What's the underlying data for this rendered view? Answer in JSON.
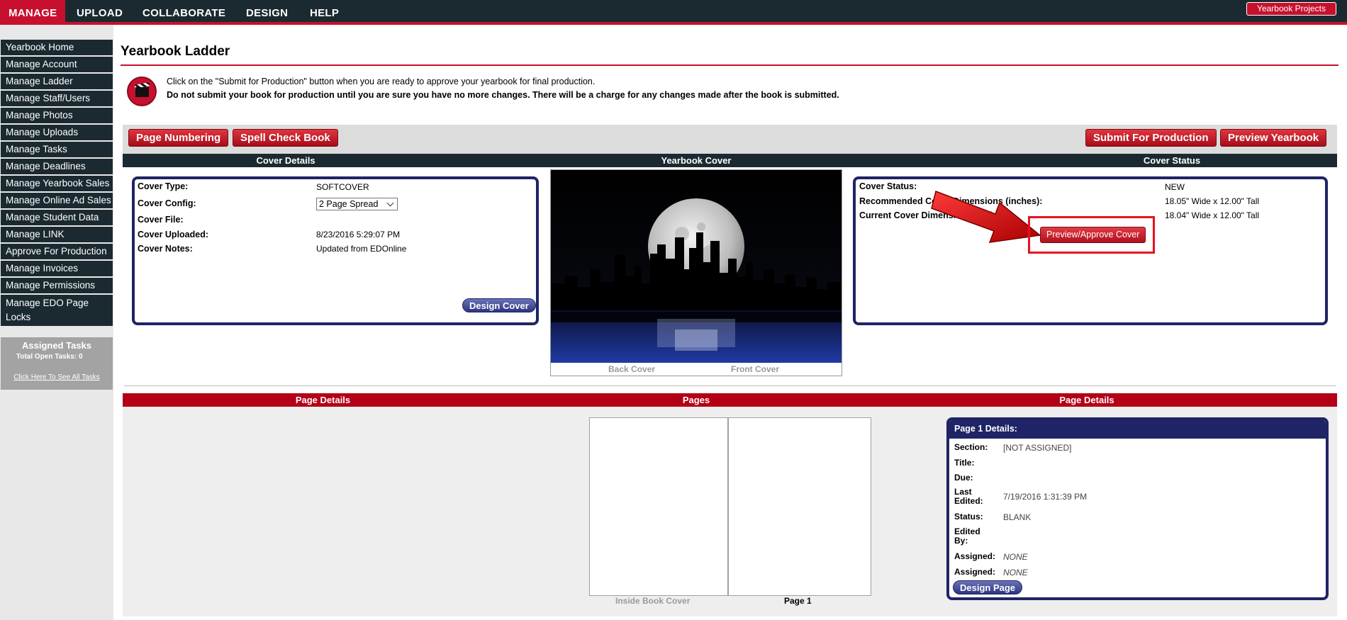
{
  "nav": {
    "tabs": [
      "MANAGE",
      "UPLOAD",
      "COLLABORATE",
      "DESIGN",
      "HELP"
    ],
    "projects_button": "Yearbook Projects"
  },
  "sidebar": {
    "items": [
      "Yearbook Home",
      "Manage Account",
      "Manage Ladder",
      "Manage Staff/Users",
      "Manage Photos",
      "Manage Uploads",
      "Manage Tasks",
      "Manage Deadlines",
      "Manage Yearbook Sales",
      "Manage Online Ad Sales",
      "Manage Student Data",
      "Manage LINK",
      "Approve For Production",
      "Manage Invoices",
      "Manage Permissions",
      "Manage EDO Page Locks"
    ],
    "tasks": {
      "title": "Assigned Tasks",
      "open": "Total Open Tasks: 0",
      "link": "Click Here To See All Tasks"
    }
  },
  "page": {
    "title": "Yearbook Ladder",
    "notice_line1": "Click on the \"Submit for Production\" button when you are ready to approve your yearbook for final production.",
    "notice_line2": "Do not submit your book for production until you are sure you have no more changes. There will be a charge for any changes made after the book is submitted."
  },
  "toolbar": {
    "page_numbering": "Page Numbering",
    "spell_check": "Spell Check Book",
    "submit": "Submit For Production",
    "preview": "Preview Yearbook"
  },
  "cover_headers": {
    "details": "Cover Details",
    "cover": "Yearbook Cover",
    "status": "Cover Status"
  },
  "cover_details": {
    "type_label": "Cover Type:",
    "type_value": "SOFTCOVER",
    "config_label": "Cover Config:",
    "config_value": "2 Page Spread",
    "file_label": "Cover File:",
    "uploaded_label": "Cover Uploaded:",
    "uploaded_value": "8/23/2016 5:29:07 PM",
    "notes_label": "Cover Notes:",
    "notes_value": "Updated from EDOnline",
    "design_button": "Design Cover"
  },
  "cover_image": {
    "back_caption": "Back Cover",
    "front_caption": "Front Cover"
  },
  "cover_status": {
    "status_label": "Cover Status:",
    "status_value": "NEW",
    "recommended_label": "Recommended Cover Dimensions (inches):",
    "recommended_value": "18.05\" Wide x 12.00\" Tall",
    "current_label": "Current Cover Dimensions (inches):",
    "current_value": "18.04\" Wide x 12.00\" Tall",
    "preview_button": "Preview/Approve Cover"
  },
  "page_headers": {
    "left": "Page Details",
    "center": "Pages",
    "right": "Page Details"
  },
  "pages": {
    "left_caption": "Inside Book Cover",
    "right_caption": "Page 1"
  },
  "page_details": {
    "title": "Page 1 Details:",
    "section_label": "Section:",
    "section_value": "[NOT ASSIGNED]",
    "title_label": "Title:",
    "due_label": "Due:",
    "last_edited_label": "Last Edited:",
    "last_edited_value": "7/19/2016 1:31:39 PM",
    "status_label": "Status:",
    "status_value": "BLANK",
    "edited_by_label": "Edited By:",
    "assigned_label": "Assigned:",
    "assigned_value": "NONE",
    "assigned2_label": "Assigned:",
    "assigned2_value": "NONE",
    "design_button": "Design Page"
  }
}
